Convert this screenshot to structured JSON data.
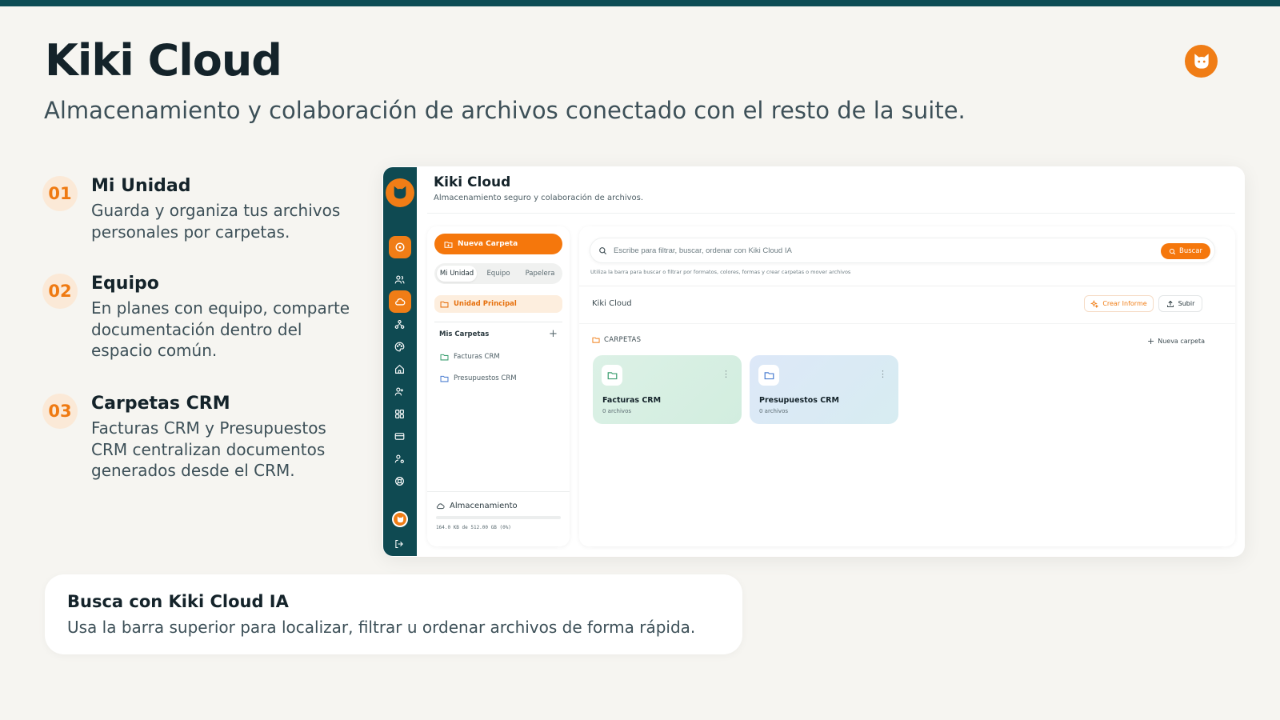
{
  "slide": {
    "title": "Kiki Cloud",
    "subtitle": "Almacenamiento y colaboración de archivos conectado con el resto de la suite.",
    "logo_icon": "cat-icon",
    "accent_color": "#f07d16",
    "dark_color": "#0f4a52"
  },
  "features": [
    {
      "num": "01",
      "title": "Mi Unidad",
      "desc": "Guarda y organiza tus archivos personales por carpetas."
    },
    {
      "num": "02",
      "title": "Equipo",
      "desc": "En planes con equipo, comparte documentación dentro del espacio común."
    },
    {
      "num": "03",
      "title": "Carpetas CRM",
      "desc": "Facturas CRM y Presupuestos CRM centralizan documentos generados desde el CRM."
    }
  ],
  "callout": {
    "title": "Busca con Kiki Cloud IA",
    "text": "Usa la barra superior para localizar, filtrar u ordenar archivos de forma rápida."
  },
  "app": {
    "title": "Kiki Cloud",
    "subtitle": "Almacenamiento seguro y colaboración de archivos.",
    "sidebar_icons": [
      "dashboard-icon",
      "contacts-icon",
      "cloud-icon",
      "org-chart-icon",
      "palette-icon",
      "home-icon",
      "team-icon",
      "apps-icon",
      "card-icon",
      "user-settings-icon",
      "support-icon"
    ],
    "active_nav": "cloud-icon",
    "new_folder_button": "Nueva Carpeta",
    "tabs": [
      "Mi Unidad",
      "Equipo",
      "Papelera"
    ],
    "active_tab": "Mi Unidad",
    "main_unit": "Unidad Principal",
    "my_folders_heading": "Mis Carpetas",
    "my_folders": [
      "Facturas CRM",
      "Presupuestos CRM"
    ],
    "storage": {
      "label": "Almacenamiento",
      "text": "164.0 KB de 512.00 GB (0%)",
      "percent": 0
    },
    "search": {
      "placeholder": "Escribe para filtrar, buscar, ordenar con Kiki Cloud IA",
      "button": "Buscar",
      "hint": "Utiliza la barra para buscar o filtrar por formatos, colores, formas y crear carpetas o mover archivos"
    },
    "breadcrumb": "Kiki Cloud",
    "report_button": "Crear Informe",
    "upload_button": "Subir",
    "folders_section": "CARPETAS",
    "new_folder_link": "Nueva carpeta",
    "folder_cards": [
      {
        "name": "Facturas CRM",
        "count": "0 archivos",
        "color": "#dcf1e6"
      },
      {
        "name": "Presupuestos CRM",
        "count": "0 archivos",
        "color": "#dde8f8"
      }
    ]
  }
}
